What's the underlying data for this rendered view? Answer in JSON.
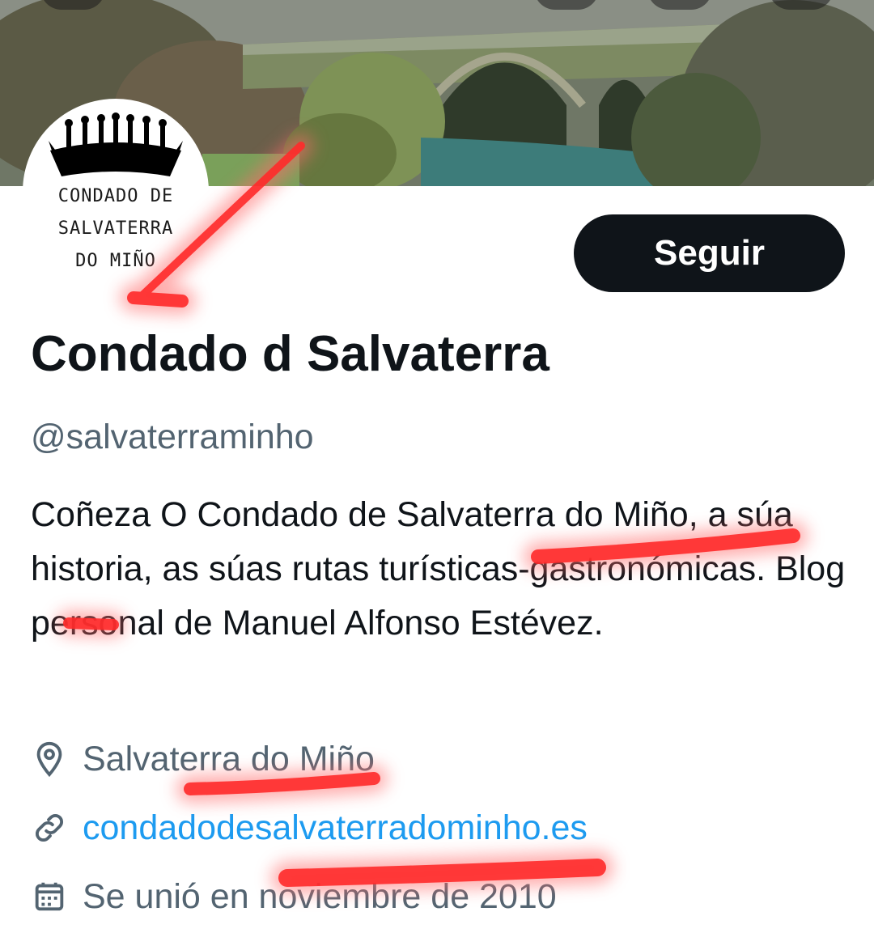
{
  "profile": {
    "display_name": "Condado d Salvaterra",
    "handle": "@salvaterraminho",
    "bio": "Coñeza O Condado de Salvaterra do Miño, a súa historia, as súas rutas turísticas-gastronómicas. Blog personal de Manuel Alfonso Estévez.",
    "location": "Salvaterra do Miño",
    "website": "condadodesalvaterradominho.es",
    "joined": "Se unió en noviembre de 2010"
  },
  "avatar": {
    "logo_text_line1": "CONDADO DE",
    "logo_text_line2": "SALVATERRA",
    "logo_text_line3": "DO MIÑO"
  },
  "actions": {
    "follow_label": "Seguir"
  },
  "icons": {
    "location": "location-pin-icon",
    "link": "link-icon",
    "calendar": "calendar-icon"
  },
  "colors": {
    "follow_button_bg": "#0f1419",
    "secondary_text": "#536471",
    "link": "#1d9bf0",
    "annotation_marks": "#ff2a2a"
  }
}
